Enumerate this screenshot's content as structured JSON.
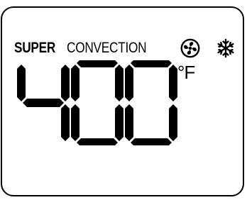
{
  "display": {
    "mode_primary": "SUPER",
    "mode_secondary": "CONVECTION",
    "temperature": "400",
    "unit": "°F",
    "icons": [
      "fan-icon",
      "snowflake-icon"
    ],
    "segment_color": "#000000",
    "background_color": "#ffffff"
  }
}
